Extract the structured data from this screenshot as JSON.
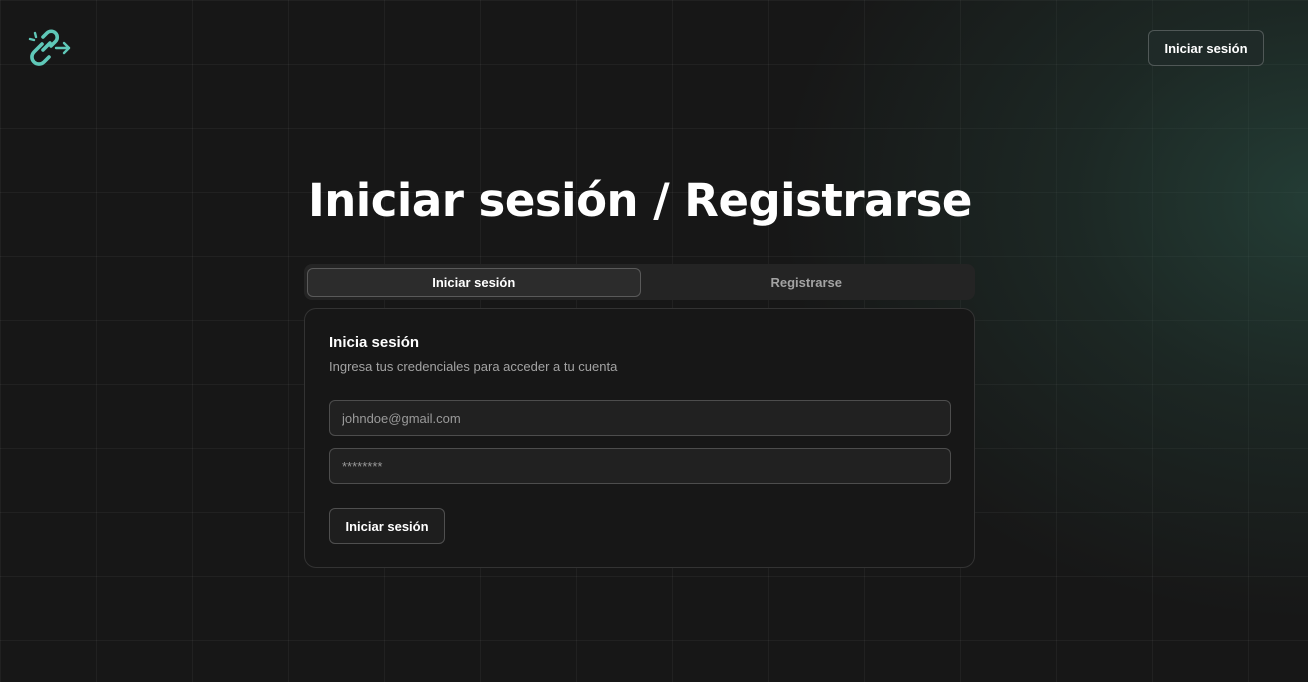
{
  "header": {
    "logo_icon": "link-arrow-icon",
    "login_button_label": "Iniciar sesión"
  },
  "page": {
    "title": "Iniciar sesión / Registrarse"
  },
  "tabs": [
    {
      "label": "Iniciar sesión",
      "active": true
    },
    {
      "label": "Registrarse",
      "active": false
    }
  ],
  "login_card": {
    "title": "Inicia sesión",
    "description": "Ingresa tus credenciales para acceder a tu cuenta",
    "email_placeholder": "johndoe@gmail.com",
    "password_placeholder": "********",
    "submit_label": "Iniciar sesión"
  },
  "colors": {
    "accent": "#5fc8b8",
    "background": "#171717",
    "glow": "#2e5c4e"
  }
}
